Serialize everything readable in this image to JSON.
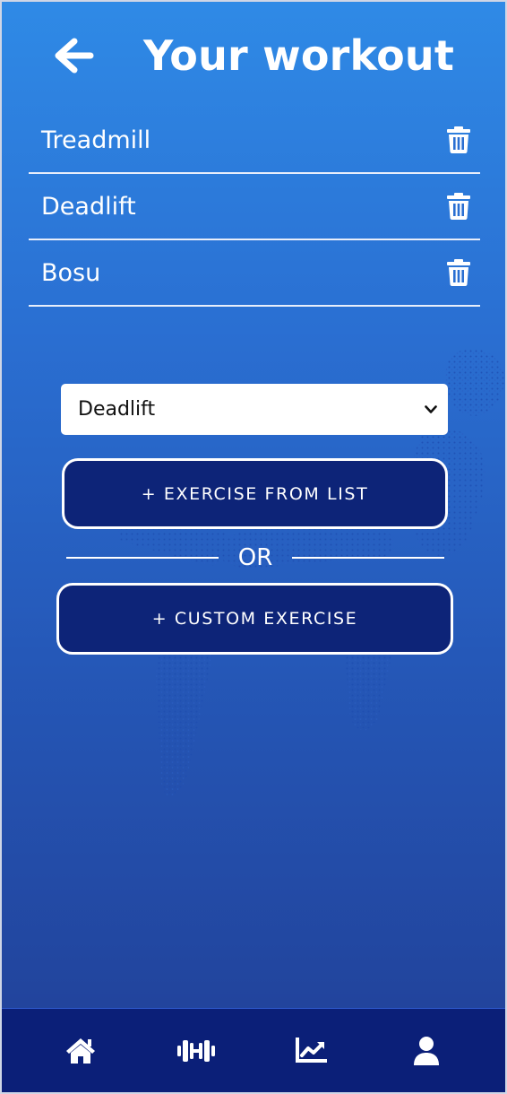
{
  "header": {
    "title": "Your workout",
    "back_icon": "arrow-left-icon"
  },
  "workout_items": [
    {
      "name": "Treadmill",
      "action_icon": "trash-icon"
    },
    {
      "name": "Deadlift",
      "action_icon": "trash-icon"
    },
    {
      "name": "Bosu",
      "action_icon": "trash-icon"
    }
  ],
  "exercise_select": {
    "selected": "Deadlift"
  },
  "buttons": {
    "add_from_list": "+ EXERCISE FROM LIST",
    "or_label": "OR",
    "add_custom": "+ CUSTOM EXERCISE"
  },
  "bottom_nav": [
    {
      "icon": "home-icon"
    },
    {
      "icon": "dumbbell-icon"
    },
    {
      "icon": "chart-line-icon"
    },
    {
      "icon": "user-icon"
    }
  ],
  "colors": {
    "background_top": "#2f8ae6",
    "background_bottom": "#213f96",
    "button_fill": "#0d2478",
    "nav_bar": "#0b1f78"
  }
}
